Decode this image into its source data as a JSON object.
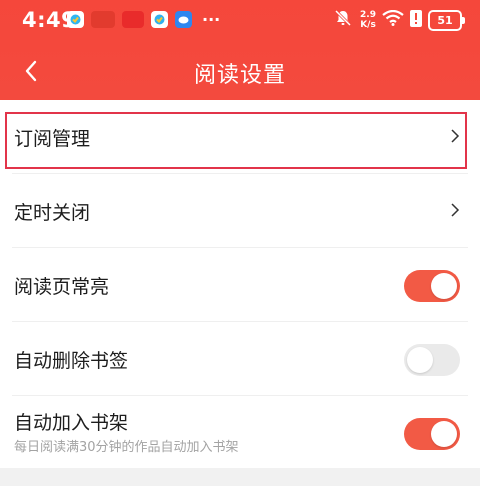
{
  "status_bar": {
    "time": "4:49",
    "net_speed_value": "2.9",
    "net_speed_unit": "K/s",
    "battery": "51",
    "more": "···"
  },
  "nav": {
    "title": "阅读设置"
  },
  "settings": [
    {
      "label": "订阅管理",
      "type": "link"
    },
    {
      "label": "定时关闭",
      "type": "link"
    },
    {
      "label": "阅读页常亮",
      "type": "toggle",
      "on": true
    },
    {
      "label": "自动删除书签",
      "type": "toggle",
      "on": false
    },
    {
      "label": "自动加入书架",
      "sublabel": "每日阅读满30分钟的作品自动加入书架",
      "type": "toggle",
      "on": true
    }
  ],
  "colors": {
    "header": "#f5473b",
    "toggle_on": "#f25a45",
    "toggle_off": "#eaeaea",
    "highlight_border": "#e2344a"
  }
}
